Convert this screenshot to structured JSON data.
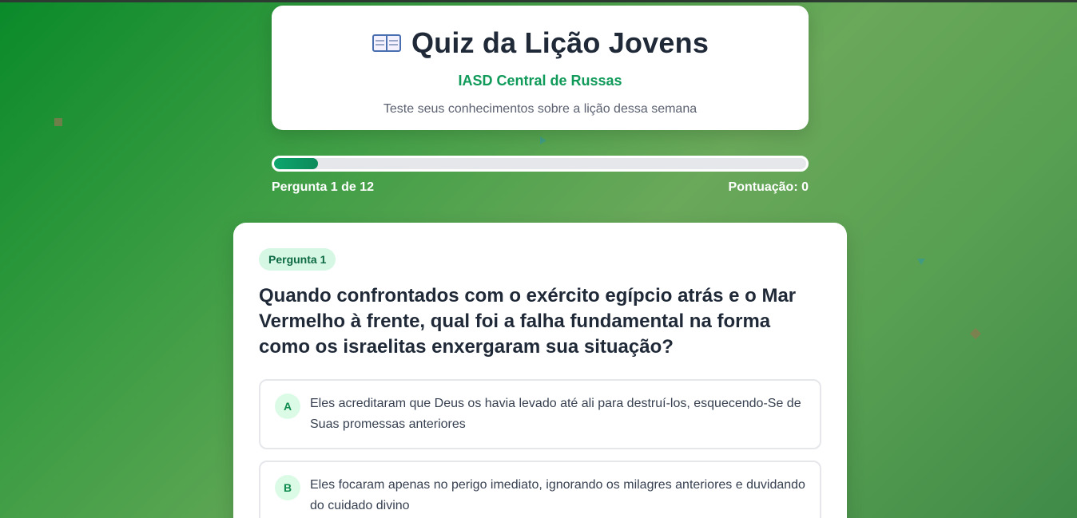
{
  "header": {
    "icon": "open-book-icon",
    "title": "Quiz da Lição Jovens",
    "church": "IASD Central de Russas",
    "subtitle": "Teste seus conhecimentos sobre a lição dessa semana"
  },
  "progress": {
    "fraction": 0.0833,
    "label": "Pergunta 1 de 12",
    "score": "Pontuação: 0"
  },
  "question": {
    "badge": "Pergunta 1",
    "text": "Quando confrontados com o exército egípcio atrás e o Mar Vermelho à frente, qual foi a falha fundamental na forma como os israelitas enxergaram sua situação?",
    "options": [
      {
        "letter": "A",
        "text": "Eles acreditaram que Deus os havia levado até ali para destruí-los, esquecendo-Se de Suas promessas anteriores"
      },
      {
        "letter": "B",
        "text": "Eles focaram apenas no perigo imediato, ignorando os milagres anteriores e duvidando do cuidado divino"
      }
    ]
  },
  "colors": {
    "accent": "#0f9a5a",
    "badge_bg": "#d5f7e4",
    "background_start": "#0a8a2a",
    "background_end": "#3f8a48"
  }
}
